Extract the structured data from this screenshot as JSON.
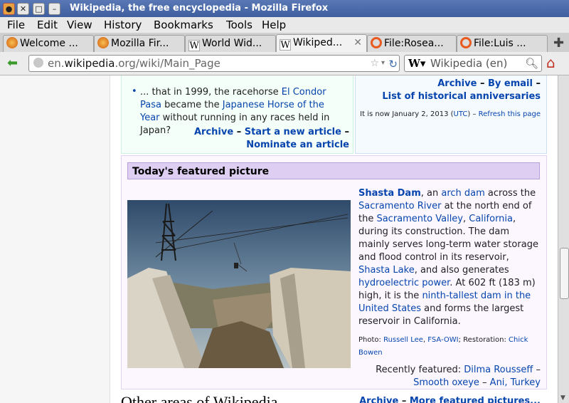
{
  "window": {
    "title": "Wikipedia, the free encyclopedia - Mozilla Firefox"
  },
  "menu": [
    "File",
    "Edit",
    "View",
    "History",
    "Bookmarks",
    "Tools",
    "Help"
  ],
  "tabs": [
    {
      "label": "Welcome ..."
    },
    {
      "label": "Mozilla Fir..."
    },
    {
      "label": "World Wid..."
    },
    {
      "label": "Wikiped..."
    },
    {
      "label": "File:Rosea..."
    },
    {
      "label": "File:Luis ..."
    }
  ],
  "nav": {
    "url_domain_pre": "en.",
    "url_domain": "wikipedia",
    "url_domain_post": ".org",
    "url_path": "/wiki/Main_Page",
    "search_placeholder": "Wikipedia (en)"
  },
  "dyk": {
    "item_prefix": "... that in 1999, the racehorse ",
    "horse": "El Condor Pasa",
    "mid": " became the ",
    "award": "Japanese Horse of the Year",
    "suffix": " without running in any races held in Japan?",
    "archive": "Archive",
    "sep1": "–",
    "start_new": "Start a new article",
    "sep2": "–",
    "nominate": "Nominate an article"
  },
  "otd": {
    "archive": "Archive",
    "sep1": "–",
    "by_email": "By email",
    "sep2": "–",
    "anniversaries": "List of historical anniversaries",
    "now_prefix": "It is now January 2, 2013 (",
    "utc": "UTC",
    "now_suffix": ") –",
    "refresh": "Refresh this page"
  },
  "featured_picture": {
    "header": "Today's featured picture",
    "desc": {
      "t1": "Shasta Dam",
      "t2": ", an ",
      "t3": "arch dam",
      "t4": " across the ",
      "t5": "Sacramento River",
      "t6": " at the north end of the ",
      "t7": "Sacramento Valley",
      "t8": ", ",
      "t9": "California",
      "t10": ", during its construction. The dam mainly serves long-term water storage and flood control in its reservoir, ",
      "t11": "Shasta Lake",
      "t12": ", and also generates ",
      "t13": "hydroelectric power",
      "t14": ". At 602 ft (183 m) high, it is the ",
      "t15": "ninth-tallest dam in the United States",
      "t16": " and forms the largest reservoir in California."
    },
    "credit": {
      "photo_label": "Photo: ",
      "photographer": "Russell Lee",
      "comma": ", ",
      "agency": "FSA-OWI",
      "restoration_label": "; Restoration: ",
      "restorer": "Chick Bowen"
    },
    "recently": {
      "label": "Recently featured: ",
      "items": [
        "Dilma Rousseff",
        "Smooth oxeye",
        "Ani, Turkey"
      ],
      "sep": "–"
    },
    "footer": {
      "archive": "Archive",
      "sep": "–",
      "more": "More featured pictures..."
    }
  },
  "next_section": {
    "title": "Other areas of Wikipedia"
  }
}
